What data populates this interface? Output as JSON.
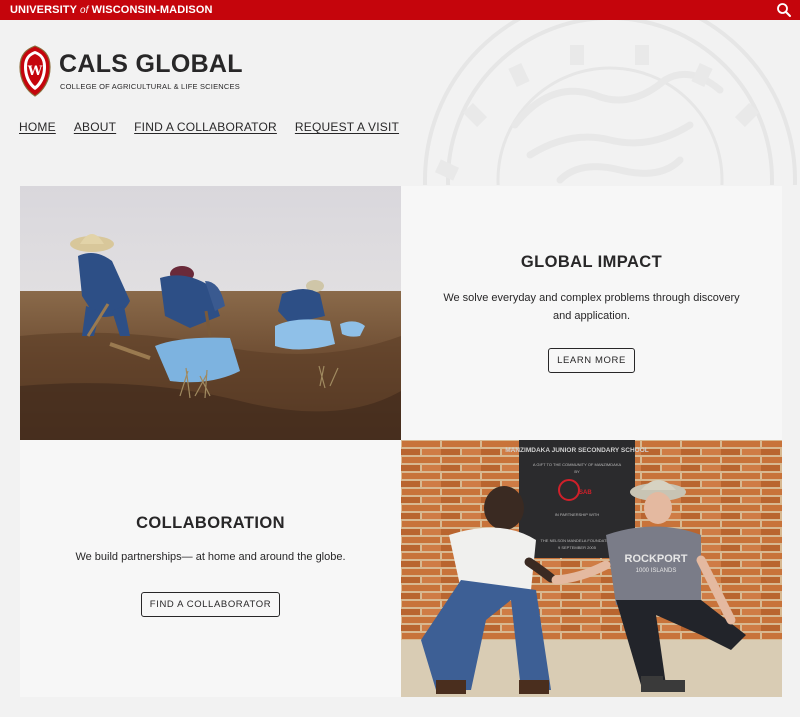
{
  "topbar": {
    "uw_link_pre": "UNIVERSITY ",
    "uw_link_of": "of",
    "uw_link_post": " WISCONSIN-MADISON",
    "search_icon": "search-icon"
  },
  "header": {
    "title": "CALS GLOBAL",
    "subtitle": "COLLEGE OF AGRICULTURAL & LIFE SCIENCES",
    "crest_letter": "W"
  },
  "nav": {
    "items": [
      {
        "label": "HOME"
      },
      {
        "label": "ABOUT"
      },
      {
        "label": "FIND A COLLABORATOR"
      },
      {
        "label": "REQUEST A VISIT"
      }
    ]
  },
  "cards": {
    "impact": {
      "heading": "GLOBAL IMPACT",
      "body": "We solve everyday and complex problems through discovery and application.",
      "button": "LEARN MORE"
    },
    "collab": {
      "heading": "COLLABORATION",
      "body": "We build partnerships— at home and around the globe.",
      "button": "FIND A COLLABORATOR"
    }
  },
  "photo_text": {
    "plaque_title": "MANZIMDAKA JUNIOR SECONDARY SCHOOL",
    "plaque_line1": "A GIFT TO THE COMMUNITY OF MANZIMDAKA",
    "plaque_line2": "BY",
    "plaque_logo": "SAB",
    "plaque_line3": "IN PARTNERSHIP WITH",
    "plaque_line4": "THE NELSON MANDELA FOUNDATION",
    "plaque_date": "9 SEPTEMBER 2005",
    "shirt_text": "ROCKPORT",
    "shirt_sub": "1000 ISLANDS"
  },
  "colors": {
    "brand_red": "#c5050c",
    "text_dark": "#282728",
    "page_bg": "#f2f2f2"
  }
}
